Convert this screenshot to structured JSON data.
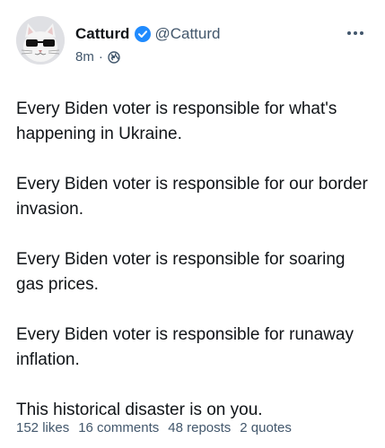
{
  "author": {
    "display_name": "Catturd",
    "handle": "@Catturd",
    "avatar_icon": "cat-with-glasses-avatar",
    "verified_icon": "verified-check-icon",
    "verified_color": "#208bfe"
  },
  "meta": {
    "time": "8m",
    "separator": "·",
    "visibility_icon": "globe-icon"
  },
  "menu_icon": "more-options-icon",
  "post": {
    "paragraphs": [
      "Every Biden voter is responsible for what's happening in Ukraine.",
      "Every Biden voter is responsible for our border invasion.",
      "Every Biden voter is responsible for soaring gas prices.",
      "Every Biden voter is responsible for runaway inflation.",
      "This historical disaster is on you."
    ]
  },
  "stats": {
    "likes": "152 likes",
    "comments": "16 comments",
    "reposts": "48 reposts",
    "quotes": "2 quotes"
  }
}
